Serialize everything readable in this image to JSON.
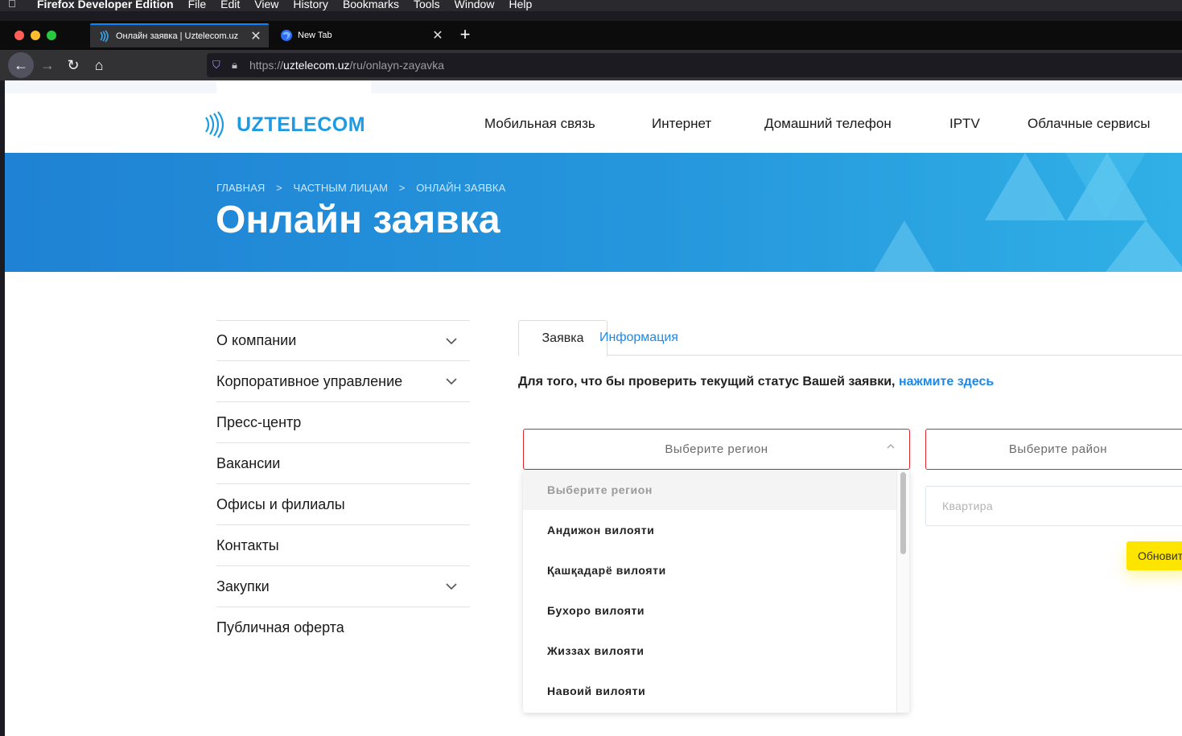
{
  "menubar": {
    "app": "Firefox Developer Edition",
    "items": [
      "File",
      "Edit",
      "View",
      "History",
      "Bookmarks",
      "Tools",
      "Window",
      "Help"
    ]
  },
  "tabs": [
    {
      "title": "Онлайн заявка | Uztelecom.uz"
    },
    {
      "title": "New Tab"
    }
  ],
  "url": {
    "scheme": "https://",
    "host": "uztelecom.uz",
    "path": "/ru/onlayn-zayavka"
  },
  "site": {
    "logo_text": "UZTELECOM",
    "nav": [
      "Мобильная связь",
      "Интернет",
      "Домашний телефон",
      "IPTV",
      "Облачные сервисы"
    ]
  },
  "hero": {
    "breadcrumbs": [
      "ГЛАВНАЯ",
      ">",
      "ЧАСТНЫМ ЛИЦАМ",
      ">",
      "ОНЛАЙН ЗАЯВКА"
    ],
    "title": "Онлайн заявка"
  },
  "sidebar": {
    "items": [
      {
        "label": "О компании",
        "expandable": true
      },
      {
        "label": "Корпоративное управление",
        "expandable": true
      },
      {
        "label": "Пресс-центр",
        "expandable": false
      },
      {
        "label": "Вакансии",
        "expandable": false
      },
      {
        "label": "Офисы и филиалы",
        "expandable": false
      },
      {
        "label": "Контакты",
        "expandable": false
      },
      {
        "label": "Закупки",
        "expandable": true
      },
      {
        "label": "Публичная оферта",
        "expandable": false
      }
    ]
  },
  "form": {
    "tabs": [
      "Заявка",
      "Информация"
    ],
    "status_text": "Для того, что бы проверить текущий статус Вашей заявки,",
    "status_link": "нажмите здесь",
    "region_placeholder": "Выберите регион",
    "district_placeholder": "Выберите район",
    "apartment_placeholder": "Квартира",
    "refresh_button": "Обновить",
    "region_options": [
      "Выберите регион",
      "Андижон вилояти",
      "Қашқадарё вилояти",
      "Бухоро вилояти",
      "Жиззах вилояти",
      "Навоий вилояти"
    ]
  },
  "colors": {
    "brand": "#1e9be0",
    "link": "#1e88e5",
    "error_border": "#d9262b",
    "button_yellow": "#fee500"
  }
}
